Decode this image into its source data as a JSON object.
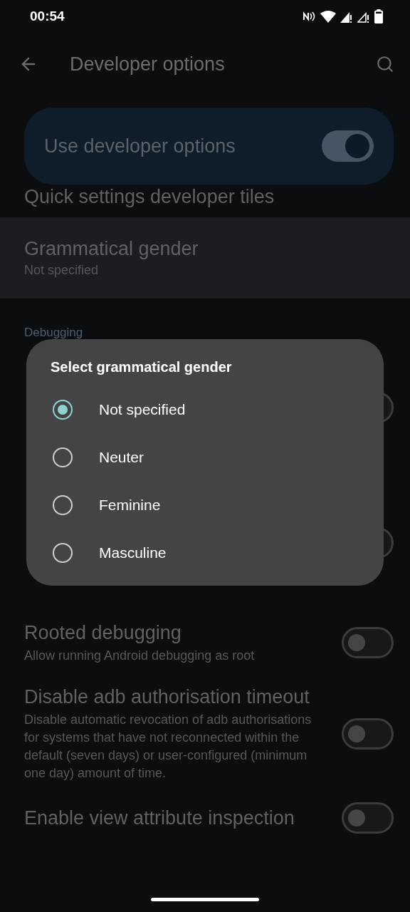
{
  "status_bar": {
    "time": "00:54"
  },
  "app_bar": {
    "title": "Developer options"
  },
  "main_switch": {
    "label": "Use developer options",
    "on": true
  },
  "items": [
    {
      "kind": "plain",
      "title": "Quick settings developer tiles"
    },
    {
      "kind": "value",
      "title": "Grammatical gender",
      "subtitle": "Not specified",
      "highlighted": true
    },
    {
      "kind": "header",
      "title": "Debugging"
    },
    {
      "kind": "hidden",
      "on": false
    },
    {
      "kind": "hidden",
      "on": false
    },
    {
      "kind": "toggle",
      "title": "Rooted debugging",
      "subtitle": "Allow running Android debugging as root",
      "on": false
    },
    {
      "kind": "toggle",
      "title": "Disable adb authorisation timeout",
      "subtitle": "Disable automatic revocation of adb authorisations for systems that have not reconnected within the default (seven days) or user-configured (minimum one day) amount of time.",
      "on": false
    },
    {
      "kind": "toggle",
      "title": "Enable view attribute inspection",
      "on": false
    }
  ],
  "dialog": {
    "title": "Select grammatical gender",
    "options": [
      {
        "label": "Not specified",
        "selected": true
      },
      {
        "label": "Neuter",
        "selected": false
      },
      {
        "label": "Feminine",
        "selected": false
      },
      {
        "label": "Masculine",
        "selected": false
      }
    ]
  }
}
